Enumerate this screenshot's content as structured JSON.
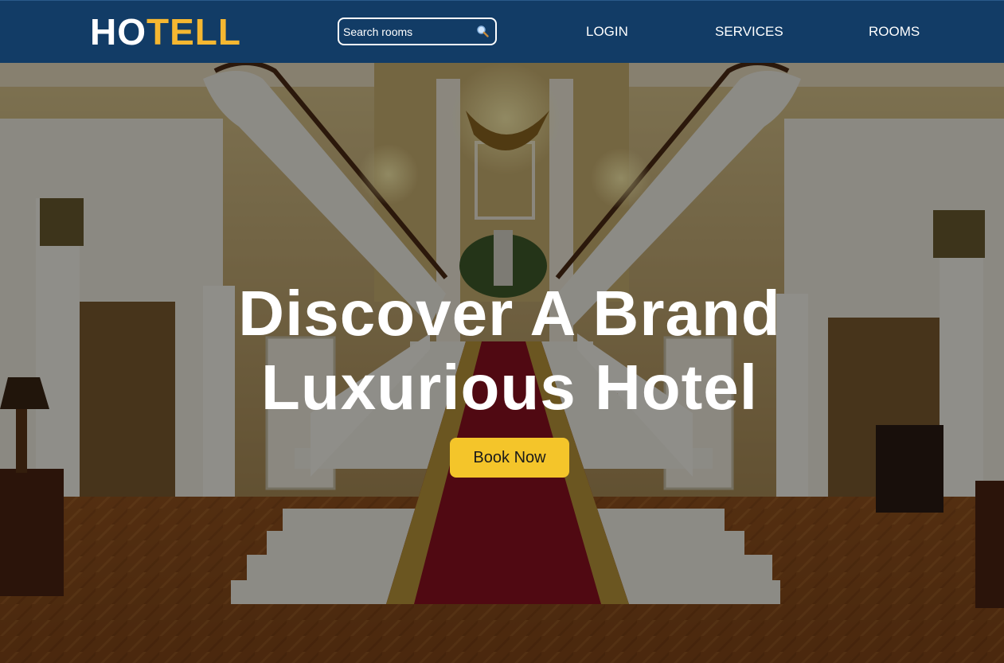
{
  "header": {
    "logo_part1": "HO",
    "logo_part2": "TELL",
    "search": {
      "placeholder": "Search rooms",
      "icon": "magnifier-icon"
    },
    "nav": {
      "login": "LOGIN",
      "services": "SERVICES",
      "rooms": "ROOMS"
    }
  },
  "hero": {
    "title_line1": "Discover A Brand",
    "title_line2": "Luxurious Hotel",
    "cta_label": "Book Now",
    "background": "grand hotel lobby with twin curved staircase, red carpet and chandelier"
  },
  "colors": {
    "navbar_bg": "#123c66",
    "logo_accent": "#f5b731",
    "cta_bg": "#f4c52a",
    "text_light": "#ffffff"
  }
}
